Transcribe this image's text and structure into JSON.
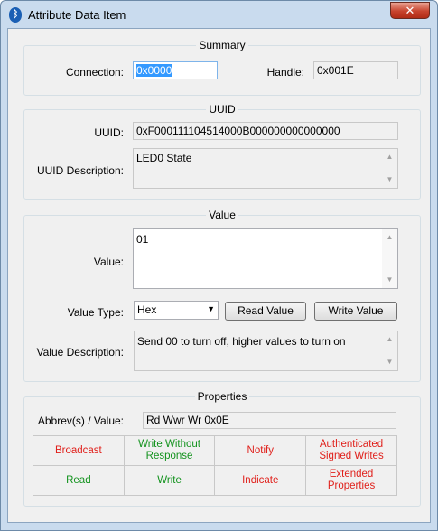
{
  "window": {
    "title": "Attribute Data Item",
    "close_symbol": "✕",
    "app_icon_symbol": "ᛒ"
  },
  "summary": {
    "title": "Summary",
    "connection_label": "Connection:",
    "connection_value": "0x0000",
    "handle_label": "Handle:",
    "handle_value": "0x001E"
  },
  "uuid": {
    "title": "UUID",
    "uuid_label": "UUID:",
    "uuid_value": "0xF000111104514000B000000000000000",
    "description_label": "UUID Description:",
    "description_value": "LED0 State"
  },
  "value": {
    "title": "Value",
    "value_label": "Value:",
    "value_value": "01",
    "type_label": "Value Type:",
    "type_selected": "Hex",
    "read_button": "Read Value",
    "write_button": "Write Value",
    "description_label": "Value Description:",
    "description_value": "Send 00 to turn off, higher values to turn on"
  },
  "properties": {
    "title": "Properties",
    "abbrev_label": "Abbrev(s) / Value:",
    "abbrev_value": "Rd Wwr Wr  0x0E",
    "cells": [
      {
        "label": "Broadcast",
        "color": "#e0201b"
      },
      {
        "label": "Write Without Response",
        "color": "#12921d"
      },
      {
        "label": "Notify",
        "color": "#e0201b"
      },
      {
        "label": "Authenticated Signed Writes",
        "color": "#e0201b"
      },
      {
        "label": "Read",
        "color": "#12921d"
      },
      {
        "label": "Write",
        "color": "#12921d"
      },
      {
        "label": "Indicate",
        "color": "#e0201b"
      },
      {
        "label": "Extended Properties",
        "color": "#e0201b"
      }
    ]
  }
}
